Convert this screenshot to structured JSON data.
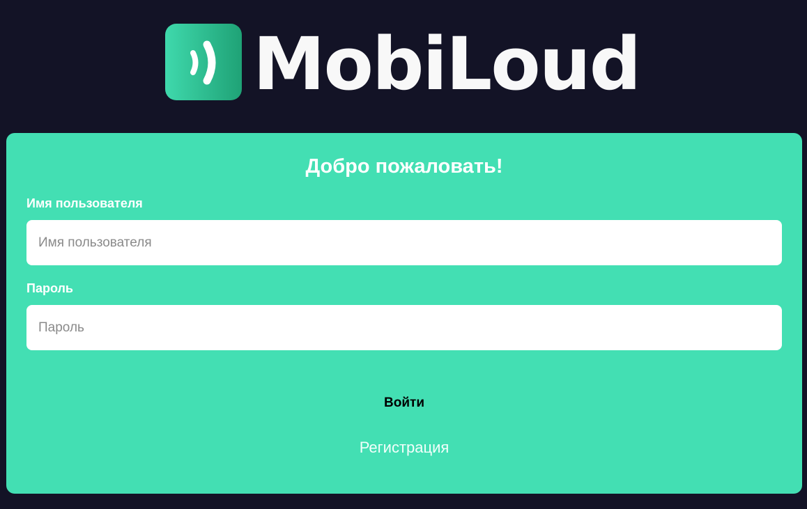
{
  "logo": {
    "wordmark": "MobiLoud",
    "icon": "sound-waves-icon"
  },
  "login_form": {
    "title": "Добро пожаловать!",
    "username": {
      "label": "Имя пользователя",
      "placeholder": "Имя пользователя",
      "value": ""
    },
    "password": {
      "label": "Пароль",
      "placeholder": "Пароль",
      "value": ""
    },
    "submit_label": "Войти",
    "register_label": "Регистрация"
  },
  "colors": {
    "page_background": "#131326",
    "card_background": "#43dfb3",
    "logo_gradient_start": "#3fd9ac",
    "logo_gradient_end": "#1fa276",
    "text_light": "#ffffff"
  }
}
